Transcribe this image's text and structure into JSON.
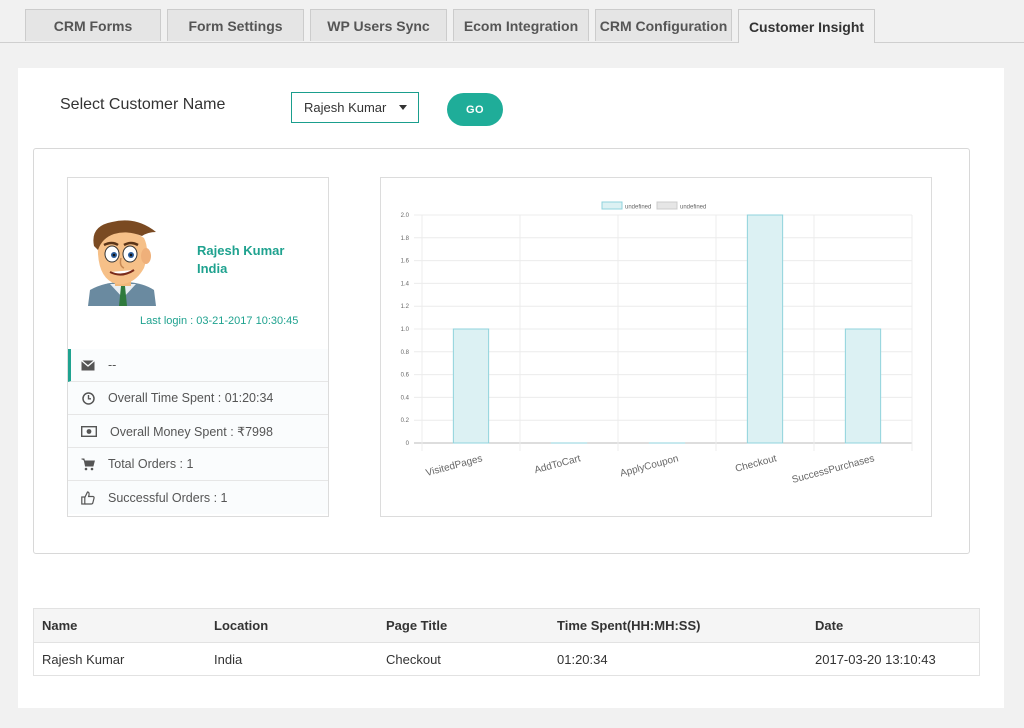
{
  "tabs": [
    {
      "label": "CRM Forms"
    },
    {
      "label": "Form Settings"
    },
    {
      "label": "WP Users Sync"
    },
    {
      "label": "Ecom Integration"
    },
    {
      "label": "CRM Configuration"
    },
    {
      "label": "Customer Insight",
      "active": true
    }
  ],
  "selector": {
    "label": "Select Customer Name",
    "selected": "Rajesh Kumar",
    "go_label": "GO"
  },
  "profile": {
    "name": "Rajesh Kumar",
    "country": "India",
    "last_login": "Last login : 03-21-2017 10:30:45",
    "info": [
      {
        "icon": "envelope-icon",
        "text": "--"
      },
      {
        "icon": "clock-icon",
        "text": "Overall Time Spent : 01:20:34"
      },
      {
        "icon": "money-icon",
        "text": "Overall Money Spent : ₹7998"
      },
      {
        "icon": "cart-icon",
        "text": "Total Orders : 1"
      },
      {
        "icon": "thumbs-up-icon",
        "text": "Successful Orders : 1"
      }
    ]
  },
  "chart_data": {
    "type": "bar",
    "categories": [
      "VisitedPages",
      "AddToCart",
      "ApplyCoupon",
      "Checkout",
      "SuccessPurchases"
    ],
    "series": [
      {
        "name": "undefined",
        "values": [
          1,
          0,
          0,
          2,
          1
        ]
      },
      {
        "name": "undefined",
        "values": [
          0,
          0,
          0,
          0,
          0
        ]
      }
    ],
    "ylim": [
      0,
      2
    ],
    "yticks": [
      "0",
      "0.2",
      "0.4",
      "0.6",
      "0.8",
      "1.0",
      "1.2",
      "1.4",
      "1.6",
      "1.8",
      "2.0"
    ],
    "grid": true,
    "legend": "top-center",
    "colors": {
      "bar_fill": "#dcf1f3",
      "bar_stroke": "#8fd3dc",
      "series2_fill": "#e6e6e6",
      "series2_stroke": "#cccccc"
    }
  },
  "table": {
    "headers": [
      "Name",
      "Location",
      "Page Title",
      "Time Spent(HH:MH:SS)",
      "Date"
    ],
    "rows": [
      [
        "Rajesh Kumar",
        "India",
        "Checkout",
        "01:20:34",
        "2017-03-20 13:10:43"
      ]
    ]
  },
  "colors": {
    "accent": "#1fad99"
  }
}
